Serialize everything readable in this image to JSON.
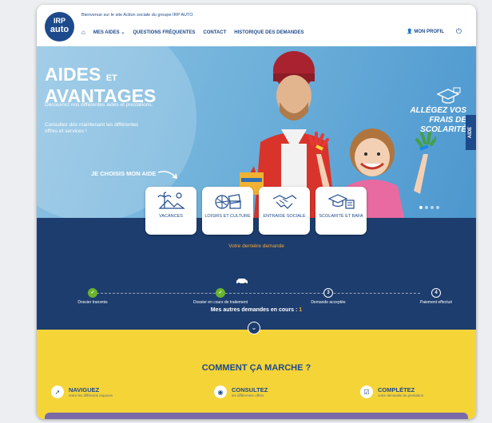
{
  "header": {
    "logo_top": "IRP",
    "logo_bottom": "auto",
    "welcome": "Bienvenue sur le site Action sociale du groupe IRP AUTO",
    "nav": [
      "MES AIDES",
      "QUESTIONS FRÉQUENTES",
      "CONTACT",
      "HISTORIQUE DES DEMANDES"
    ],
    "profile": "MON PROFIL"
  },
  "hero": {
    "title_line1_main": "AIDES",
    "title_line1_small": "ET",
    "title_line2": "AVANTAGES",
    "desc1": "Découvrez nos différentes aides et prestations.",
    "desc2": "Consultez dès maintenant les différentes offres et services !",
    "choose": "JE CHOISIS MON AIDE",
    "promo": "ALLÉGEZ VOS FRAIS DE SCOLARITÉ",
    "side_tab": "AIDE",
    "slides": 4,
    "active_slide": 1
  },
  "cards": [
    "VACANCES",
    "LOISIRS ET CULTURE",
    "ENTRAIDE SOCIALE",
    "SCOLARITÉ ET BAFA"
  ],
  "status": {
    "last_request": "Votre dernière demande",
    "steps": [
      {
        "label": "Dossier transmis",
        "state": "done"
      },
      {
        "label": "Dossier en cours de traitement",
        "state": "done"
      },
      {
        "label": "Demande acceptée",
        "state": "todo",
        "num": "3"
      },
      {
        "label": "Paiement effectué",
        "state": "todo",
        "num": "4"
      }
    ],
    "other_text": "Mes autres demandes en cours :",
    "other_count": "1"
  },
  "how": {
    "title": "COMMENT ÇA MARCHE ?",
    "features": [
      {
        "title": "NAVIGUEZ",
        "sub": "entre les différents espaces",
        "icon": "cursor-icon"
      },
      {
        "title": "CONSULTEZ",
        "sub": "les différentes offres",
        "icon": "eye-icon"
      },
      {
        "title": "COMPLÉTEZ",
        "sub": "votre demande de prestation",
        "icon": "checkbox-icon"
      }
    ]
  },
  "colors": {
    "navy": "#1d3d6e",
    "brand_blue": "#1d4a8c",
    "yellow": "#f5d438",
    "orange": "#f5a637",
    "green": "#6ab42d"
  }
}
